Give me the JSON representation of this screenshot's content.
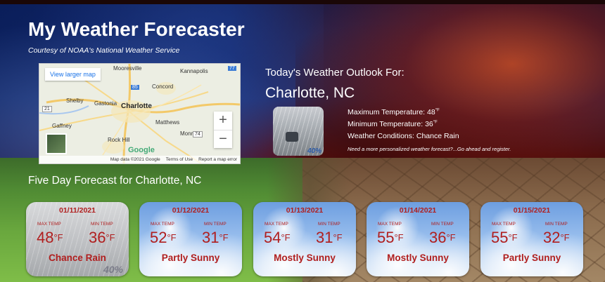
{
  "header": {
    "title": "My Weather Forecaster",
    "subtitle": "Courtesy of NOAA's National Weather Service"
  },
  "map": {
    "view_larger_label": "View larger map",
    "zoom_in": "+",
    "zoom_out": "−",
    "city": "Charlotte",
    "labels": [
      "Mooresville",
      "Concord",
      "Gastonia",
      "Shelby",
      "Matthews",
      "Monroe",
      "Gaffney",
      "Rock Hill",
      "Kannapolis"
    ],
    "road_shields": [
      "77",
      "85",
      "74",
      "21"
    ],
    "google_label": "Google",
    "footer": [
      "Map data ©2021 Google",
      "Terms of Use",
      "Report a map error"
    ]
  },
  "outlook": {
    "heading": "Today's Weather Outlook For:",
    "city": "Charlotte, NC",
    "icon": "rain-icon",
    "precip_pct": "40%",
    "max_temp_label": "Maximum Temperature: 48",
    "min_temp_label": "Minimum Temperature: 36",
    "degree_unit": "°F",
    "conditions_label": "Weather Conditions: Chance Rain",
    "register_note": "Need a more personalized weather forecast?...Go ahead and register."
  },
  "five_day": {
    "heading": "Five Day Forecast for Charlotte, NC",
    "max_label": "MAX TEMP",
    "min_label": "MIN TEMP",
    "unit": "°F",
    "days": [
      {
        "date": "01/11/2021",
        "max": "48",
        "min": "36",
        "condition": "Chance Rain",
        "pct": "40%",
        "icon": "rain-icon"
      },
      {
        "date": "01/12/2021",
        "max": "52",
        "min": "31",
        "condition": "Partly Sunny",
        "pct": "",
        "icon": "partly-sunny-icon"
      },
      {
        "date": "01/13/2021",
        "max": "54",
        "min": "31",
        "condition": "Mostly Sunny",
        "pct": "",
        "icon": "mostly-sunny-icon"
      },
      {
        "date": "01/14/2021",
        "max": "55",
        "min": "36",
        "condition": "Mostly Sunny",
        "pct": "",
        "icon": "mostly-sunny-icon"
      },
      {
        "date": "01/15/2021",
        "max": "55",
        "min": "32",
        "condition": "Partly Sunny",
        "pct": "",
        "icon": "partly-sunny-icon"
      }
    ]
  },
  "colors": {
    "accent_red": "#b01e1e",
    "map_link": "#1a73e8"
  }
}
